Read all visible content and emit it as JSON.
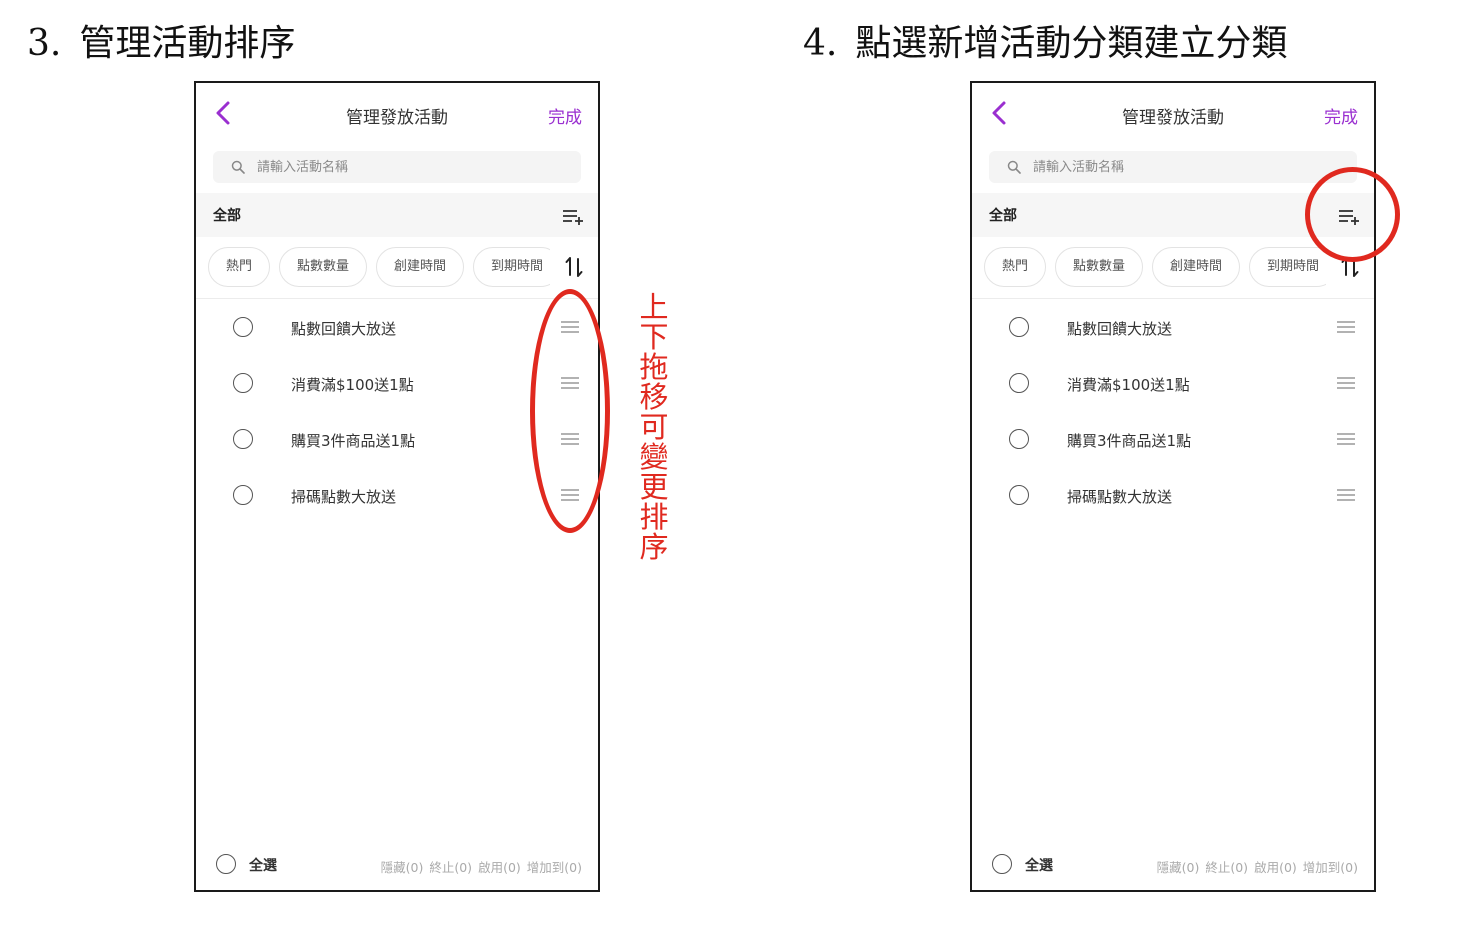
{
  "steps": [
    {
      "number": "3.",
      "title": "管理活動排序",
      "phone": {
        "nav_title": "管理發放活動",
        "done_label": "完成",
        "search_placeholder": "請輸入活動名稱",
        "category_label": "全部",
        "chips": [
          "熱門",
          "點數數量",
          "創建時間",
          "到期時間"
        ],
        "items": [
          "點數回饋大放送",
          "消費滿$100送1點",
          "購買3件商品送1點",
          "掃碼點數大放送"
        ],
        "footer": {
          "select_all": "全選",
          "actions": [
            "隱藏(0)",
            "終止(0)",
            "啟用(0)",
            "增加到(0)"
          ]
        }
      },
      "annotation": "上下拖移可變更排序"
    },
    {
      "number": "4.",
      "title": "點選新增活動分類建立分類",
      "phone": {
        "nav_title": "管理發放活動",
        "done_label": "完成",
        "search_placeholder": "請輸入活動名稱",
        "category_label": "全部",
        "chips": [
          "熱門",
          "點數數量",
          "創建時間",
          "到期時間"
        ],
        "items": [
          "點數回饋大放送",
          "消費滿$100送1點",
          "購買3件商品送1點",
          "掃碼點數大放送"
        ],
        "footer": {
          "select_all": "全選",
          "actions": [
            "隱藏(0)",
            "終止(0)",
            "啟用(0)",
            "增加到(0)"
          ]
        }
      }
    }
  ],
  "colors": {
    "accent": "#9a2fd0",
    "annotation": "#e0291f"
  },
  "icons": [
    "back-chevron-icon",
    "search-icon",
    "add-category-icon",
    "sort-icon",
    "drag-handle-icon"
  ]
}
